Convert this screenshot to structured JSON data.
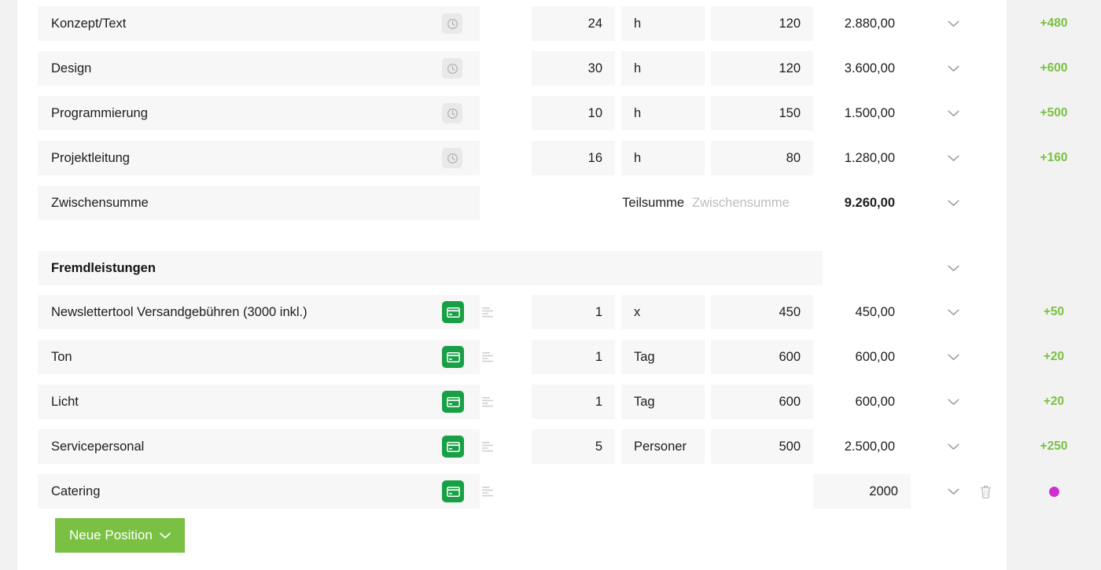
{
  "colors": {
    "accent_green": "#7ac143",
    "icon_green": "#18a046",
    "magenta_dot": "#d12fcb",
    "field_bg": "#f7f7f7",
    "gutter_bg": "#f2f2f2"
  },
  "subtotal_row": {
    "name": "Zwischensumme",
    "label_teilsumme": "Teilsumme",
    "placeholder_zwischensumme": "Zwischensumme",
    "total": "9.260,00"
  },
  "group_header": {
    "title": "Fremdleistungen"
  },
  "buttons": {
    "new_position": "Neue Position",
    "new_position_chevron": "chevron-down-icon"
  },
  "icons": {
    "clock": "clock-icon",
    "card": "credit-card-icon",
    "list": "text-lines-icon",
    "chevron": "chevron-down-icon",
    "trash": "trash-icon",
    "dot": "status-dot-icon"
  },
  "services": [
    {
      "name": "Konzept/Text",
      "qty": "24",
      "unit": "h",
      "price": "120",
      "total": "2.880,00",
      "badge": "+480",
      "icon": "clock-icon"
    },
    {
      "name": "Design",
      "qty": "30",
      "unit": "h",
      "price": "120",
      "total": "3.600,00",
      "badge": "+600",
      "icon": "clock-icon"
    },
    {
      "name": "Programmierung",
      "qty": "10",
      "unit": "h",
      "price": "150",
      "total": "1.500,00",
      "badge": "+500",
      "icon": "clock-icon"
    },
    {
      "name": "Projektleitung",
      "qty": "16",
      "unit": "h",
      "price": "80",
      "total": "1.280,00",
      "badge": "+160",
      "icon": "clock-icon"
    }
  ],
  "external": [
    {
      "name": "Newslettertool Versandgebühren (3000 inkl.)",
      "qty": "1",
      "unit": "x",
      "price": "450",
      "total": "450,00",
      "badge": "+50",
      "icon": "credit-card-icon"
    },
    {
      "name": "Ton",
      "qty": "1",
      "unit": "Tag",
      "price": "600",
      "total": "600,00",
      "badge": "+20",
      "icon": "credit-card-icon"
    },
    {
      "name": "Licht",
      "qty": "1",
      "unit": "Tag",
      "price": "600",
      "total": "600,00",
      "badge": "+20",
      "icon": "credit-card-icon"
    },
    {
      "name": "Servicepersonal",
      "qty": "5",
      "unit": "Personer",
      "price": "500",
      "total": "2.500,00",
      "badge": "+250",
      "icon": "credit-card-icon"
    }
  ],
  "catering_row": {
    "name": "Catering",
    "qty": "",
    "unit": "",
    "price": "",
    "total": "2000",
    "badge": "",
    "icon": "credit-card-icon",
    "has_trash": true,
    "has_dot": true
  }
}
